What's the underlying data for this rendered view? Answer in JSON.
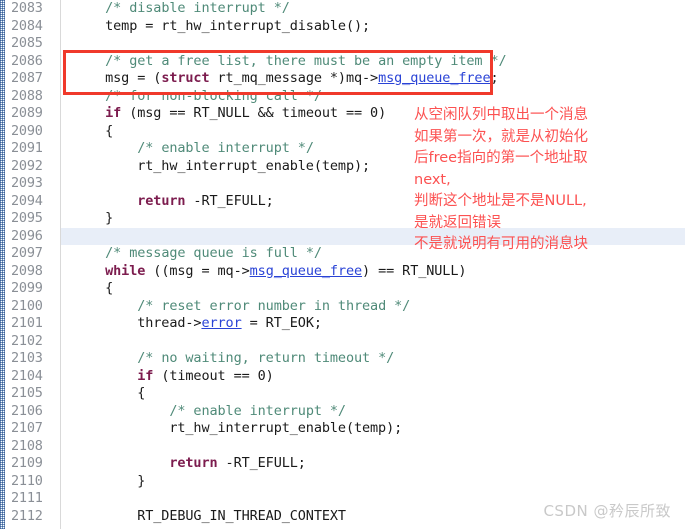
{
  "editor": {
    "first_line_number": 2083,
    "line_height": 17.5,
    "highlighted_line_number": 2096,
    "gutter_line_numbers": [
      "2083",
      "2084",
      "2085",
      "2086",
      "2087",
      "2088",
      "2089",
      "2090",
      "2091",
      "2092",
      "2093",
      "2094",
      "2095",
      "2096",
      "2097",
      "2098",
      "2099",
      "2100",
      "2101",
      "2102",
      "2103",
      "2104",
      "2105",
      "2106",
      "2107",
      "2108",
      "2109",
      "2110",
      "2111",
      "2112"
    ],
    "lines": [
      {
        "number": "2083",
        "tokens": [
          {
            "t": "    ",
            "c": "pln"
          },
          {
            "t": "/* disable interrupt */",
            "c": "cmt"
          }
        ]
      },
      {
        "number": "2084",
        "tokens": [
          {
            "t": "    temp = rt_hw_interrupt_disable();",
            "c": "pln"
          }
        ]
      },
      {
        "number": "2085",
        "tokens": [
          {
            "t": "",
            "c": "pln"
          }
        ]
      },
      {
        "number": "2086",
        "tokens": [
          {
            "t": "    ",
            "c": "pln"
          },
          {
            "t": "/* get a free list, there must be an empty item */",
            "c": "cmt"
          }
        ]
      },
      {
        "number": "2087",
        "tokens": [
          {
            "t": "    msg = (",
            "c": "pln"
          },
          {
            "t": "struct",
            "c": "kw"
          },
          {
            "t": " rt_mq_message *)mq->",
            "c": "pln"
          },
          {
            "t": "msg_queue_free",
            "c": "mem"
          },
          {
            "t": ";",
            "c": "pln"
          }
        ]
      },
      {
        "number": "2088",
        "tokens": [
          {
            "t": "    ",
            "c": "pln"
          },
          {
            "t": "/* for non-blocking call */",
            "c": "cmt"
          }
        ]
      },
      {
        "number": "2089",
        "tokens": [
          {
            "t": "    ",
            "c": "pln"
          },
          {
            "t": "if",
            "c": "kw"
          },
          {
            "t": " (msg == RT_NULL && timeout == 0)",
            "c": "pln"
          }
        ]
      },
      {
        "number": "2090",
        "tokens": [
          {
            "t": "    {",
            "c": "pln"
          }
        ]
      },
      {
        "number": "2091",
        "tokens": [
          {
            "t": "        ",
            "c": "pln"
          },
          {
            "t": "/* enable interrupt */",
            "c": "cmt"
          }
        ]
      },
      {
        "number": "2092",
        "tokens": [
          {
            "t": "        rt_hw_interrupt_enable(temp);",
            "c": "pln"
          }
        ]
      },
      {
        "number": "2093",
        "tokens": [
          {
            "t": "",
            "c": "pln"
          }
        ]
      },
      {
        "number": "2094",
        "tokens": [
          {
            "t": "        ",
            "c": "pln"
          },
          {
            "t": "return",
            "c": "kw"
          },
          {
            "t": " -RT_EFULL;",
            "c": "pln"
          }
        ]
      },
      {
        "number": "2095",
        "tokens": [
          {
            "t": "    }",
            "c": "pln"
          }
        ]
      },
      {
        "number": "2096",
        "tokens": [
          {
            "t": "",
            "c": "pln"
          }
        ]
      },
      {
        "number": "2097",
        "tokens": [
          {
            "t": "    ",
            "c": "pln"
          },
          {
            "t": "/* message queue is full */",
            "c": "cmt"
          }
        ]
      },
      {
        "number": "2098",
        "tokens": [
          {
            "t": "    ",
            "c": "pln"
          },
          {
            "t": "while",
            "c": "kw"
          },
          {
            "t": " ((msg = mq->",
            "c": "pln"
          },
          {
            "t": "msg_queue_free",
            "c": "mem"
          },
          {
            "t": ") == RT_NULL)",
            "c": "pln"
          }
        ]
      },
      {
        "number": "2099",
        "tokens": [
          {
            "t": "    {",
            "c": "pln"
          }
        ]
      },
      {
        "number": "2100",
        "tokens": [
          {
            "t": "        ",
            "c": "pln"
          },
          {
            "t": "/* reset error number in thread */",
            "c": "cmt"
          }
        ]
      },
      {
        "number": "2101",
        "tokens": [
          {
            "t": "        thread->",
            "c": "pln"
          },
          {
            "t": "error",
            "c": "mem"
          },
          {
            "t": " = RT_EOK;",
            "c": "pln"
          }
        ]
      },
      {
        "number": "2102",
        "tokens": [
          {
            "t": "",
            "c": "pln"
          }
        ]
      },
      {
        "number": "2103",
        "tokens": [
          {
            "t": "        ",
            "c": "pln"
          },
          {
            "t": "/* no waiting, return timeout */",
            "c": "cmt"
          }
        ]
      },
      {
        "number": "2104",
        "tokens": [
          {
            "t": "        ",
            "c": "pln"
          },
          {
            "t": "if",
            "c": "kw"
          },
          {
            "t": " (timeout == 0)",
            "c": "pln"
          }
        ]
      },
      {
        "number": "2105",
        "tokens": [
          {
            "t": "        {",
            "c": "pln"
          }
        ]
      },
      {
        "number": "2106",
        "tokens": [
          {
            "t": "            ",
            "c": "pln"
          },
          {
            "t": "/* enable interrupt */",
            "c": "cmt"
          }
        ]
      },
      {
        "number": "2107",
        "tokens": [
          {
            "t": "            rt_hw_interrupt_enable(temp);",
            "c": "pln"
          }
        ]
      },
      {
        "number": "2108",
        "tokens": [
          {
            "t": "",
            "c": "pln"
          }
        ]
      },
      {
        "number": "2109",
        "tokens": [
          {
            "t": "            ",
            "c": "pln"
          },
          {
            "t": "return",
            "c": "kw"
          },
          {
            "t": " -RT_EFULL;",
            "c": "pln"
          }
        ]
      },
      {
        "number": "2110",
        "tokens": [
          {
            "t": "        }",
            "c": "pln"
          }
        ]
      },
      {
        "number": "2111",
        "tokens": [
          {
            "t": "",
            "c": "pln"
          }
        ]
      },
      {
        "number": "2112",
        "tokens": [
          {
            "t": "        RT_DEBUG_IN_THREAD_CONTEXT",
            "c": "pln"
          }
        ]
      }
    ]
  },
  "red_box": {
    "label": "highlight-box",
    "covers_lines": [
      "2086",
      "2087"
    ],
    "color": "#f0392b"
  },
  "annotation": {
    "color": "#fc5151",
    "lines": [
      "从空闲队列中取出一个消息",
      "如果第一次，就是从初始化",
      "后free指向的第一个地址取",
      "next,",
      "判断这个地址是不是NULL,",
      "是就返回错误",
      "不是就说明有可用的消息块"
    ]
  },
  "watermark": {
    "text": "CSDN @矜辰所致",
    "color": "#c9c9c9"
  },
  "colors": {
    "comment": "#4f8a78",
    "keyword": "#7c1c4e",
    "member": "#2a43d6",
    "plain": "#1a1a1a",
    "line_number": "#8a8f96",
    "current_line_highlight": "#e8eef8",
    "box_border": "#f0392b",
    "annotation": "#fc5151"
  }
}
